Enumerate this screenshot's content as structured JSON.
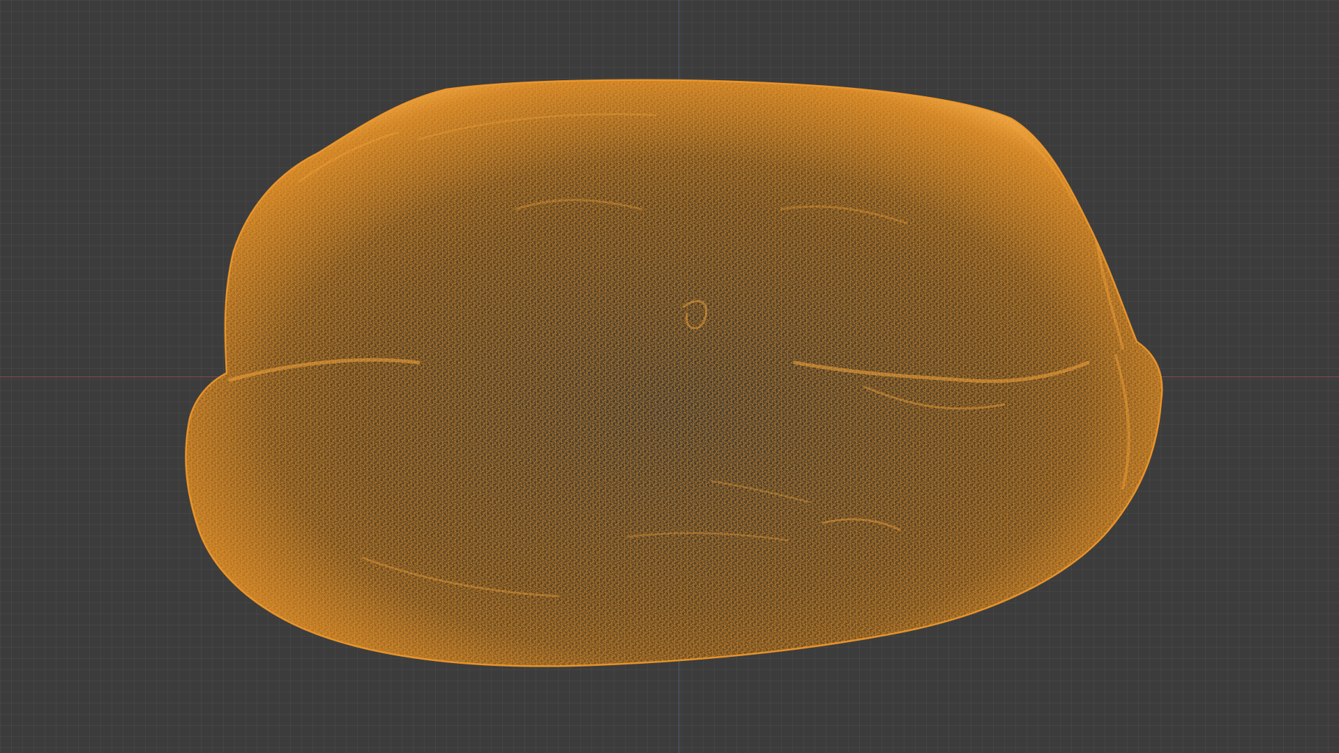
{
  "viewport": {
    "background_color": "#3c3c3c",
    "grid_color": "#474747",
    "x_axis_color": "#c8505a",
    "y_axis_color": "#5a82c8"
  },
  "object": {
    "display_mode": "wireframe",
    "wire_color": "#f39a2b",
    "body_shadow_color": "#6b4a1c",
    "body_mid_color": "#8a5c20"
  }
}
